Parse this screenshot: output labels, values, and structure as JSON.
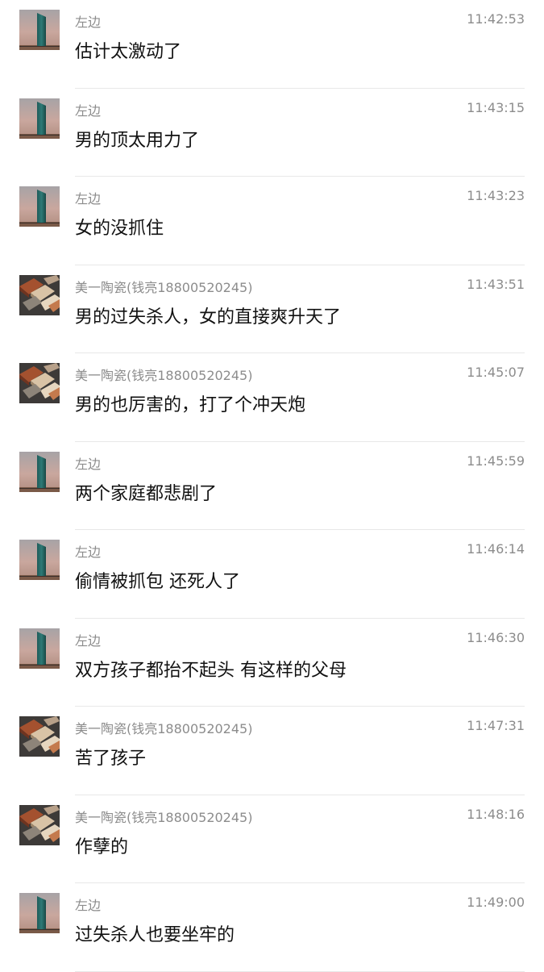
{
  "messages": [
    {
      "sender": "左边",
      "time": "11:42:53",
      "text": "估计太激动了",
      "avatar": "tower-avatar-icon"
    },
    {
      "sender": "左边",
      "time": "11:43:15",
      "text": "男的顶太用力了",
      "avatar": "tower-avatar-icon"
    },
    {
      "sender": "左边",
      "time": "11:43:23",
      "text": "女的没抓住",
      "avatar": "tower-avatar-icon"
    },
    {
      "sender": "美一陶瓷(钱亮18800520245)",
      "time": "11:43:51",
      "text": "男的过失杀人，女的直接爽升天了",
      "avatar": "tiles-avatar-icon"
    },
    {
      "sender": "美一陶瓷(钱亮18800520245)",
      "time": "11:45:07",
      "text": "男的也厉害的，打了个冲天炮",
      "avatar": "tiles-avatar-icon"
    },
    {
      "sender": "左边",
      "time": "11:45:59",
      "text": "两个家庭都悲剧了",
      "avatar": "tower-avatar-icon"
    },
    {
      "sender": "左边",
      "time": "11:46:14",
      "text": "偷情被抓包 还死人了",
      "avatar": "tower-avatar-icon"
    },
    {
      "sender": "左边",
      "time": "11:46:30",
      "text": "双方孩子都抬不起头 有这样的父母",
      "avatar": "tower-avatar-icon"
    },
    {
      "sender": "美一陶瓷(钱亮18800520245)",
      "time": "11:47:31",
      "text": "苦了孩子",
      "avatar": "tiles-avatar-icon"
    },
    {
      "sender": "美一陶瓷(钱亮18800520245)",
      "time": "11:48:16",
      "text": "作孽的",
      "avatar": "tiles-avatar-icon"
    },
    {
      "sender": "左边",
      "time": "11:49:00",
      "text": "过失杀人也要坐牢的",
      "avatar": "tower-avatar-icon"
    }
  ]
}
